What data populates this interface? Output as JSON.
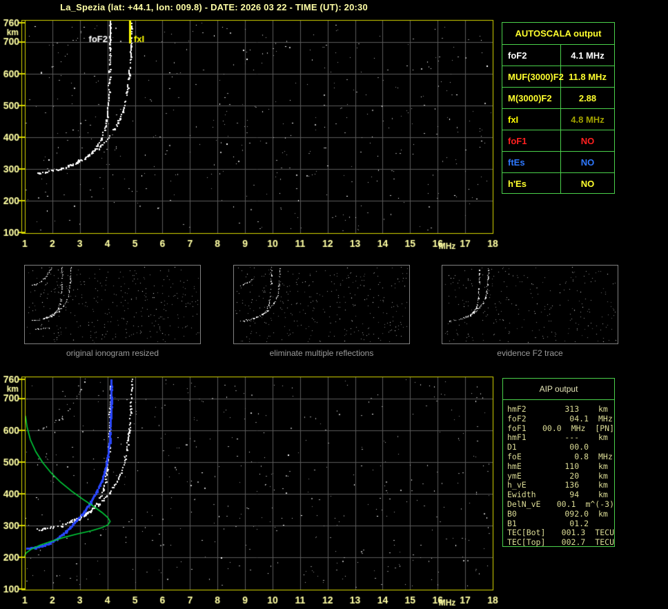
{
  "header": {
    "title": "La_Spezia (lat: +44.1, lon: 009.8) - DATE: 2026 03 22 - TIME (UT): 20:30"
  },
  "autoscala": {
    "title": "AUTOSCALA output",
    "rows": [
      {
        "label": "foF2",
        "value": "4.1 MHz",
        "label_color": "#ffffff",
        "value_color": "#ffffff"
      },
      {
        "label": "MUF(3000)F2",
        "value": "11.8 MHz",
        "label_color": "#ffff2e",
        "value_color": "#ffff2e"
      },
      {
        "label": "M(3000)F2",
        "value": "2.88",
        "label_color": "#ffff2e",
        "value_color": "#ffff2e"
      },
      {
        "label": "fxI",
        "value": "4.8 MHz",
        "label_color": "#ffff00",
        "value_color": "#a3a300"
      },
      {
        "label": "foF1",
        "value": "NO",
        "label_color": "#ff2020",
        "value_color": "#ff2020"
      },
      {
        "label": "ftEs",
        "value": "NO",
        "label_color": "#2e78ff",
        "value_color": "#2e78ff"
      },
      {
        "label": "h'Es",
        "value": "NO",
        "label_color": "#ffff2e",
        "value_color": "#ffff2e"
      }
    ]
  },
  "aip": {
    "title": "AIP output",
    "rows": [
      {
        "label": "hmF2",
        "value": "313  ",
        "unit": "km"
      },
      {
        "label": "foF2",
        "value": "04.1",
        "unit": "MHz"
      },
      {
        "label": "foF1",
        "value": "00.0",
        "unit": "MHz  [PN]"
      },
      {
        "label": "hmF1",
        "value": "---  ",
        "unit": "km"
      },
      {
        "label": "D1",
        "value": "00.0",
        "unit": ""
      },
      {
        "label": "foE",
        "value": "0.8",
        "unit": "MHz"
      },
      {
        "label": "hmE",
        "value": "110  ",
        "unit": "km"
      },
      {
        "label": "ymE",
        "value": "20  ",
        "unit": "km"
      },
      {
        "label": "h_vE",
        "value": "136  ",
        "unit": "km"
      },
      {
        "label": "Ewidth",
        "value": "94  ",
        "unit": "km"
      },
      {
        "label": "DelN_vE",
        "value": "00.1",
        "unit": "m^(-3)"
      },
      {
        "label": "B0",
        "value": "092.0",
        "unit": "km"
      },
      {
        "label": "B1",
        "value": "01.2",
        "unit": ""
      },
      {
        "label": "TEC[Bot]",
        "value": "001.3",
        "unit": "TECU"
      },
      {
        "label": "TEC[Top]",
        "value": "002.7",
        "unit": "TECU"
      }
    ]
  },
  "colors": {
    "axis_text": "#ffffa3",
    "plot_border": "#d9d900",
    "grid": "#5b5b5b",
    "table_border": "#4bd24b",
    "trace_white": "#ffffff",
    "fit_blue": "#2946ff",
    "profile_green": "#00cf39",
    "caption_gray": "#9b9b9b",
    "foF2_marker": "#ffffff",
    "fxI_marker": "#ffff00"
  },
  "chart_data": {
    "type": "scatter",
    "x_axis": {
      "label": "MHz",
      "min": 1,
      "max": 18,
      "ticks": [
        1,
        2,
        3,
        4,
        5,
        6,
        7,
        8,
        9,
        10,
        11,
        12,
        13,
        14,
        15,
        16,
        17,
        18
      ]
    },
    "y_axis": {
      "label": "km",
      "min": 100,
      "max": 760,
      "ticks": [
        760,
        700,
        600,
        500,
        400,
        300,
        200,
        100
      ],
      "gridlines": [
        700,
        600,
        500,
        400,
        300,
        200
      ]
    },
    "scaled_values": {
      "foF2_MHz": 4.1,
      "fxI_MHz": 4.8,
      "hmF2_km": 313
    },
    "traces": {
      "f2_o_mode": [
        [
          1.45,
          288
        ],
        [
          1.7,
          291
        ],
        [
          2.0,
          296
        ],
        [
          2.3,
          302
        ],
        [
          2.6,
          310
        ],
        [
          2.9,
          320
        ],
        [
          3.15,
          333
        ],
        [
          3.4,
          350
        ],
        [
          3.6,
          372
        ],
        [
          3.78,
          400
        ],
        [
          3.9,
          435
        ],
        [
          3.98,
          478
        ],
        [
          4.03,
          535
        ],
        [
          4.06,
          610
        ],
        [
          4.08,
          690
        ],
        [
          4.09,
          760
        ]
      ],
      "f2_x_mode": [
        [
          2.55,
          312
        ],
        [
          2.9,
          325
        ],
        [
          3.3,
          344
        ],
        [
          3.7,
          370
        ],
        [
          4.0,
          398
        ],
        [
          4.25,
          428
        ],
        [
          4.45,
          462
        ],
        [
          4.6,
          500
        ],
        [
          4.7,
          545
        ],
        [
          4.77,
          600
        ],
        [
          4.82,
          660
        ],
        [
          4.85,
          715
        ],
        [
          4.87,
          760
        ]
      ],
      "multiple_reflection": [
        [
          1.45,
          600
        ],
        [
          1.9,
          615
        ],
        [
          2.3,
          640
        ],
        [
          2.6,
          668
        ],
        [
          2.85,
          700
        ],
        [
          3.05,
          735
        ],
        [
          3.2,
          760
        ]
      ],
      "multiple_reflection_partial": [
        [
          1.45,
          598
        ],
        [
          1.8,
          610
        ],
        [
          2.15,
          630
        ],
        [
          2.45,
          652
        ]
      ],
      "es_trace": [
        [
          1.5,
          212
        ],
        [
          1.9,
          216
        ],
        [
          2.3,
          221
        ],
        [
          2.7,
          227
        ],
        [
          3.0,
          233
        ]
      ],
      "model_fit_blue": [
        [
          1.05,
          230
        ],
        [
          1.35,
          233
        ],
        [
          1.6,
          238
        ],
        [
          1.85,
          246
        ],
        [
          2.1,
          258
        ],
        [
          2.35,
          274
        ],
        [
          2.6,
          294
        ],
        [
          2.85,
          318
        ],
        [
          3.1,
          344
        ],
        [
          3.35,
          374
        ],
        [
          3.6,
          410
        ],
        [
          3.8,
          450
        ],
        [
          3.95,
          500
        ],
        [
          4.05,
          565
        ],
        [
          4.1,
          650
        ],
        [
          4.12,
          760
        ]
      ],
      "density_profile_green": [
        [
          1.02,
          645
        ],
        [
          1.08,
          610
        ],
        [
          1.2,
          570
        ],
        [
          1.4,
          532
        ],
        [
          1.65,
          498
        ],
        [
          1.95,
          466
        ],
        [
          2.3,
          436
        ],
        [
          2.7,
          408
        ],
        [
          3.1,
          383
        ],
        [
          3.5,
          360
        ],
        [
          3.8,
          341
        ],
        [
          4.0,
          326
        ],
        [
          4.1,
          313
        ],
        [
          4.02,
          302
        ],
        [
          3.8,
          293
        ],
        [
          3.4,
          283
        ],
        [
          2.9,
          273
        ],
        [
          2.4,
          262
        ],
        [
          1.95,
          250
        ],
        [
          1.55,
          238
        ],
        [
          1.25,
          226
        ],
        [
          1.05,
          214
        ],
        [
          0.98,
          203
        ]
      ]
    },
    "top_chart": {
      "markers": [
        {
          "label": "foF2",
          "f": 4.1,
          "color": "#ffffff",
          "side": "left",
          "width": 2
        },
        {
          "label": "fxI",
          "f": 4.8,
          "color": "#ffff00",
          "side": "right",
          "width": 3
        }
      ],
      "white_series": [
        "f2_o_mode",
        "f2_x_mode"
      ],
      "faint_series": [
        "multiple_reflection"
      ],
      "noise_seed": 7,
      "noise_count": 440
    },
    "bottom_chart": {
      "markers": [],
      "white_series": [
        "f2_o_mode",
        "f2_x_mode"
      ],
      "faint_series": [
        "multiple_reflection"
      ],
      "blue_series": "model_fit_blue",
      "green_series": "density_profile_green",
      "noise_seed": 13,
      "noise_count": 440
    },
    "thumbnails": [
      {
        "caption": "original ionogram resized",
        "white_series": [
          "f2_o_mode",
          "f2_x_mode",
          "multiple_reflection",
          "es_trace"
        ],
        "noise_seed": 21,
        "noise_count": 330
      },
      {
        "caption": "eliminate multiple reflections",
        "white_series": [
          "f2_o_mode",
          "f2_x_mode",
          "multiple_reflection_partial"
        ],
        "noise_seed": 29,
        "noise_count": 320
      },
      {
        "caption": "evidence F2 trace",
        "white_series": [
          "f2_o_mode",
          "f2_x_mode"
        ],
        "noise_seed": 35,
        "noise_count": 260
      }
    ]
  }
}
